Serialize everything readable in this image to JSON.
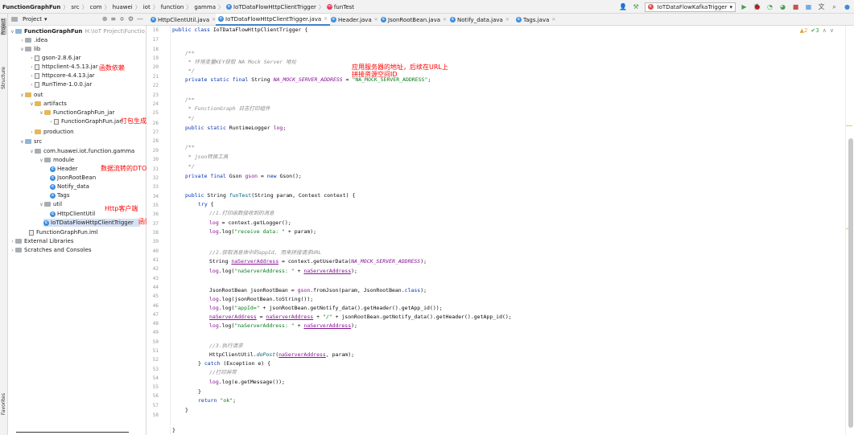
{
  "navbar": {
    "breadcrumbs": [
      "FunctionGraphFun",
      "src",
      "com",
      "huawei",
      "iot",
      "function",
      "gamma",
      "IoTDataFlowHttpClientTrigger",
      "funTest"
    ],
    "run_config": "IoTDataFlowKafkaTrigger",
    "user_icon": "user-icon"
  },
  "stripe": {
    "project": "Project",
    "structure": "Structure",
    "favorites": "Favorites"
  },
  "project_panel": {
    "title": "Project"
  },
  "tree": [
    {
      "label": "FunctionGraphFun",
      "extra": "H:\\IoT Project\\Functio",
      "indent": 0,
      "type": "root"
    },
    {
      "label": ".idea",
      "indent": 1,
      "type": "folder"
    },
    {
      "label": "lib",
      "indent": 1,
      "type": "folder"
    },
    {
      "label": "gson-2.8.6.jar",
      "indent": 2,
      "type": "jar"
    },
    {
      "label": "httpclient-4.5.13.jar",
      "indent": 2,
      "type": "jar"
    },
    {
      "label": "httpcore-4.4.13.jar",
      "indent": 2,
      "type": "jar"
    },
    {
      "label": "RunTime-1.0.0.jar",
      "indent": 2,
      "type": "jar"
    },
    {
      "label": "out",
      "indent": 1,
      "type": "folder-orange"
    },
    {
      "label": "artifacts",
      "indent": 2,
      "type": "folder-orange"
    },
    {
      "label": "FunctionGraphFun_jar",
      "indent": 3,
      "type": "folder-orange"
    },
    {
      "label": "FunctionGraphFun.jar",
      "indent": 4,
      "type": "jar"
    },
    {
      "label": "production",
      "indent": 2,
      "type": "folder-orange"
    },
    {
      "label": "src",
      "indent": 1,
      "type": "folder-blue"
    },
    {
      "label": "com.huawei.iot.function.gamma",
      "indent": 2,
      "type": "package"
    },
    {
      "label": "module",
      "indent": 3,
      "type": "package"
    },
    {
      "label": "Header",
      "indent": 4,
      "type": "class"
    },
    {
      "label": "JsonRootBean",
      "indent": 4,
      "type": "class"
    },
    {
      "label": "Notify_data",
      "indent": 4,
      "type": "class"
    },
    {
      "label": "Tags",
      "indent": 4,
      "type": "class"
    },
    {
      "label": "util",
      "indent": 3,
      "type": "package"
    },
    {
      "label": "HttpClientUtil",
      "indent": 4,
      "type": "class"
    },
    {
      "label": "IoTDataFlowHttpClientTrigger",
      "indent": 3,
      "type": "class",
      "selected": true
    },
    {
      "label": "FunctionGraphFun.iml",
      "indent": 1,
      "type": "file"
    },
    {
      "label": "External Libraries",
      "indent": 0,
      "type": "lib"
    },
    {
      "label": "Scratches and Consoles",
      "indent": 0,
      "type": "scratch"
    }
  ],
  "annotations": {
    "lib_deps": "函数依赖",
    "jar_output": "打包生成的函数Jar",
    "dto": "数据流转的DTO",
    "http_client": "Http客户端",
    "entry": "函数入口",
    "server_addr_1": "应用服务器的地址，后续在URL上",
    "server_addr_2": "拼接资源空间ID"
  },
  "tabs": [
    {
      "label": "HttpClientUtil.java",
      "active": false
    },
    {
      "label": "IoTDataFlowHttpClientTrigger.java",
      "active": true
    },
    {
      "label": "Header.java",
      "active": false
    },
    {
      "label": "JsonRootBean.java",
      "active": false
    },
    {
      "label": "Notify_data.java",
      "active": false
    },
    {
      "label": "Tags.java",
      "active": false
    }
  ],
  "inspection": {
    "warnings": "▲2",
    "ok": "✔3"
  },
  "line_numbers": [
    "16",
    "17",
    "18",
    "19",
    "20",
    "21",
    "22",
    "23",
    "24",
    "25",
    "26",
    "27",
    "28",
    "29",
    "30",
    "31",
    "32",
    "33",
    "34",
    "35",
    "36",
    "37",
    "38",
    "39",
    "40",
    "41",
    "42",
    "43",
    "44",
    "45",
    "46",
    "47",
    "48",
    "49",
    "50",
    "51",
    "52",
    "53",
    "54",
    "55",
    "56",
    "57",
    "58"
  ],
  "code": {
    "l16a": "public class ",
    "l16b": "IoTDataFlowHttpClientTrigger {",
    "l18": "/**",
    "l19": " * 环境变量KEY获取 NA Mock Server 地址",
    "l20": " */",
    "l21a": "private static final ",
    "l21b": "String ",
    "l21c": "NA_MOCK_SERVER_ADDRESS",
    "l21d": " = ",
    "l21e": "\"NA_MOCK_SERVER_ADDRESS\"",
    "l21f": ";",
    "l23": "/**",
    "l24": " * FunctionGraph 日志打印组件",
    "l25": " */",
    "l26a": "public static ",
    "l26b": "RuntimeLogger ",
    "l26c": "log",
    "l26d": ";",
    "l28": "/**",
    "l29": " * json转换工具",
    "l30": " */",
    "l31a": "private final ",
    "l31b": "Gson ",
    "l31c": "gson",
    "l31d": " = ",
    "l31e": "new ",
    "l31f": "Gson();",
    "l33a": "public ",
    "l33b": "String ",
    "l33c": "funTest",
    "l33d": "(String param, Context context) {",
    "l34a": "try",
    "l34b": " {",
    "l35": "//1.打印函数接收到的消息",
    "l36a": "log",
    "l36b": " = context.getLogger();",
    "l37a": "log",
    "l37b": ".log(",
    "l37c": "\"receive data: \"",
    "l37d": " + param);",
    "l39": "//2.获取消息体中的appId, 用来拼接请求URL",
    "l40a": "String ",
    "l40b": "naServerAddress",
    "l40c": " = context.getUserData(",
    "l40d": "NA_MOCK_SERVER_ADDRESS",
    "l40e": ");",
    "l41a": "log",
    "l41b": ".log(",
    "l41c": "\"naServerAddress: \"",
    "l41d": " + ",
    "l41e": "naServerAddress",
    "l41f": ");",
    "l43a": "JsonRootBean jsonRootBean = ",
    "l43b": "gson",
    "l43c": ".fromJson(param, JsonRootBean.",
    "l43d": "class",
    "l43e": ");",
    "l44a": "log",
    "l44b": ".log(jsonRootBean.toString());",
    "l45a": "log",
    "l45b": ".log(",
    "l45c": "\"appId=\"",
    "l45d": " + jsonRootBean.getNotify_data().getHeader().getApp_id());",
    "l46a": "naServerAddress",
    "l46b": " = ",
    "l46c": "naServerAddress",
    "l46d": " + ",
    "l46e": "\"/\"",
    "l46f": " + jsonRootBean.getNotify_data().getHeader().getApp_id();",
    "l47a": "log",
    "l47b": ".log(",
    "l47c": "\"naServerAddress: \"",
    "l47d": " + ",
    "l47e": "naServerAddress",
    "l47f": ");",
    "l49": "//3.执行请求",
    "l50a": "HttpClientUtil.",
    "l50b": "doPost",
    "l50c": "(",
    "l50d": "naServerAddress",
    "l50e": ", param);",
    "l51a": "} ",
    "l51b": "catch",
    "l51c": " (Exception e) {",
    "l52": "//打印异常",
    "l53a": "log",
    "l53b": ".log(e.getMessage());",
    "l54": "}",
    "l55a": "return ",
    "l55b": "\"ok\"",
    "l55c": ";",
    "l56": "}",
    "l58": "}"
  }
}
